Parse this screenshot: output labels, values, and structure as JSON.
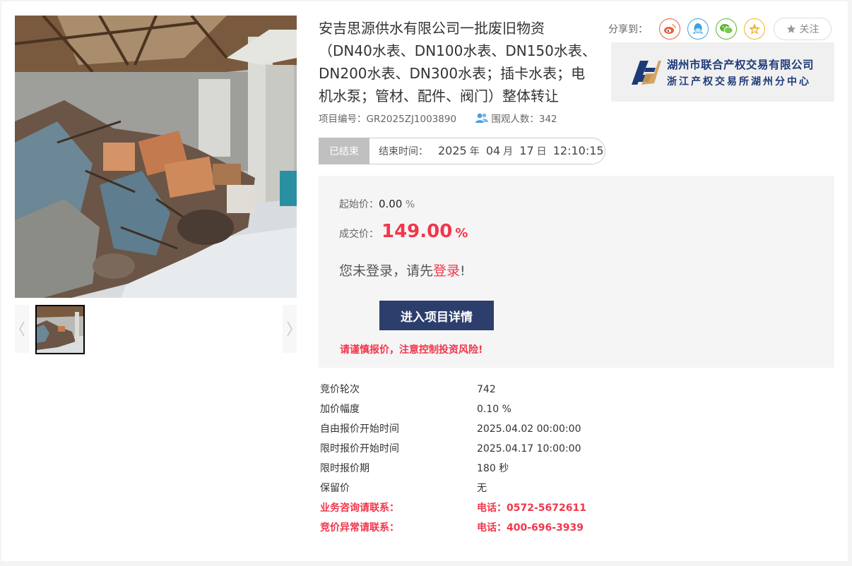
{
  "title": "安吉思源供水有限公司一批废旧物资（DN40水表、DN100水表、DN150水表、DN200水表、DN300水表；插卡水表；电机水泵；管材、配件、阀门）整体转让",
  "project_no": "项目编号：GR2025ZJ1003890",
  "viewers": "围观人数：342",
  "share": {
    "label": "分享到：",
    "follow": "关注"
  },
  "org": {
    "name": "湖州市联合产权交易有限公司",
    "sub": "浙江产权交易所湖州分中心"
  },
  "status": {
    "tag": "已结束",
    "end_label": "结束时间：",
    "year": "2025",
    "year_u": "年",
    "month": "04",
    "month_u": "月",
    "day": "17",
    "day_u": "日",
    "time": "12:10:15"
  },
  "price": {
    "start_label": "起始价：",
    "start_value": "0.00",
    "start_unit": "%",
    "deal_label": "成交价：",
    "deal_value": "149.00",
    "deal_unit": "%",
    "login_prefix": "您未登录，请先",
    "login_link": "登录",
    "login_suffix": "!",
    "enter_button": "进入项目详情",
    "risk": "请谨慎报价，注意控制投资风险!"
  },
  "info": [
    {
      "k": "竞价轮次",
      "v": "742"
    },
    {
      "k": "加价幅度",
      "v": "0.10 %"
    },
    {
      "k": "自由报价开始时间",
      "v": "2025.04.02 00:00:00"
    },
    {
      "k": "限时报价开始时间",
      "v": "2025.04.17 10:00:00"
    },
    {
      "k": "限时报价期",
      "v": "180 秒"
    },
    {
      "k": "保留价",
      "v": "无"
    },
    {
      "k": "业务咨询请联系：",
      "v": "电话：0572-5672611"
    },
    {
      "k": "竞价异常请联系：",
      "v": "电话：400-696-3939"
    }
  ],
  "colors": {
    "accent_red": "#f2364c",
    "button_navy": "#2c3e6b",
    "weibo": "#e6603a",
    "qq": "#3aa3e3",
    "wechat": "#5cb531",
    "qzone": "#f0b32a"
  },
  "icons": [
    "weibo-icon",
    "qq-icon",
    "wechat-icon",
    "qzone-icon",
    "star-icon",
    "users-icon",
    "chevron-left-icon",
    "chevron-right-icon"
  ]
}
